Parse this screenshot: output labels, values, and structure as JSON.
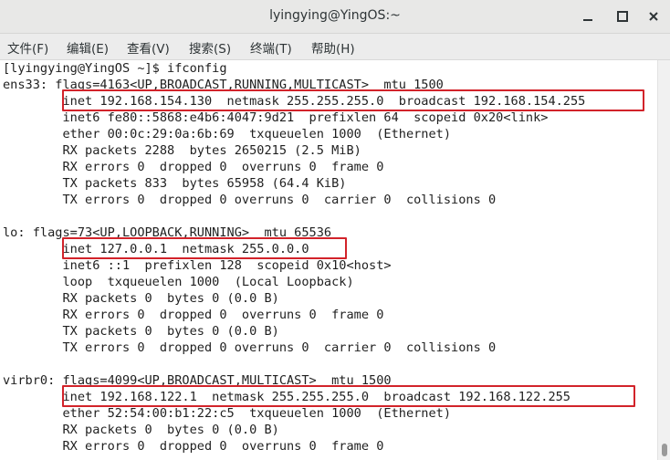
{
  "window": {
    "title": "lyingying@YingOS:~"
  },
  "menu": [
    "文件(F)",
    "编辑(E)",
    "查看(V)",
    "搜索(S)",
    "终端(T)",
    "帮助(H)"
  ],
  "terminal": {
    "lines": [
      "[lyingying@YingOS ~]$ ifconfig",
      "ens33: flags=4163<UP,BROADCAST,RUNNING,MULTICAST>  mtu 1500",
      "        inet 192.168.154.130  netmask 255.255.255.0  broadcast 192.168.154.255",
      "        inet6 fe80::5868:e4b6:4047:9d21  prefixlen 64  scopeid 0x20<link>",
      "        ether 00:0c:29:0a:6b:69  txqueuelen 1000  (Ethernet)",
      "        RX packets 2288  bytes 2650215 (2.5 MiB)",
      "        RX errors 0  dropped 0  overruns 0  frame 0",
      "        TX packets 833  bytes 65958 (64.4 KiB)",
      "        TX errors 0  dropped 0 overruns 0  carrier 0  collisions 0",
      "",
      "lo: flags=73<UP,LOOPBACK,RUNNING>  mtu 65536",
      "        inet 127.0.0.1  netmask 255.0.0.0",
      "        inet6 ::1  prefixlen 128  scopeid 0x10<host>",
      "        loop  txqueuelen 1000  (Local Loopback)",
      "        RX packets 0  bytes 0 (0.0 B)",
      "        RX errors 0  dropped 0  overruns 0  frame 0",
      "        TX packets 0  bytes 0 (0.0 B)",
      "        TX errors 0  dropped 0 overruns 0  carrier 0  collisions 0",
      "",
      "virbr0: flags=4099<UP,BROADCAST,MULTICAST>  mtu 1500",
      "        inet 192.168.122.1  netmask 255.255.255.0  broadcast 192.168.122.255",
      "        ether 52:54:00:b1:22:c5  txqueuelen 1000  (Ethernet)",
      "        RX packets 0  bytes 0 (0.0 B)",
      "        RX errors 0  dropped 0  overruns 0  frame 0"
    ]
  },
  "colors": {
    "highlight": "#d2232a",
    "text": "#1f1f1f",
    "titlebar": "#e8e8e7"
  }
}
